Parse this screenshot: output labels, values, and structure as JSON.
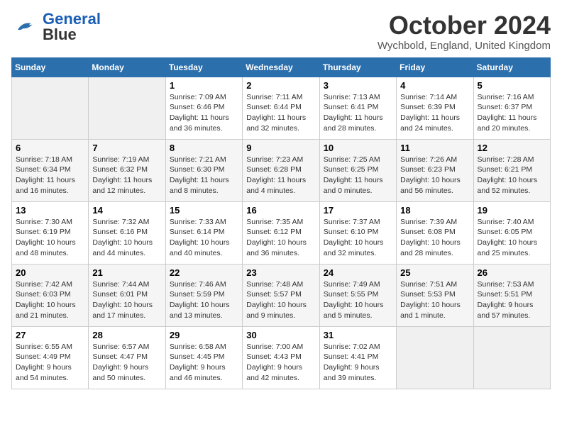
{
  "header": {
    "logo_line1": "General",
    "logo_line2": "Blue",
    "month": "October 2024",
    "location": "Wychbold, England, United Kingdom"
  },
  "days_of_week": [
    "Sunday",
    "Monday",
    "Tuesday",
    "Wednesday",
    "Thursday",
    "Friday",
    "Saturday"
  ],
  "weeks": [
    [
      {
        "day": "",
        "detail": ""
      },
      {
        "day": "",
        "detail": ""
      },
      {
        "day": "1",
        "detail": "Sunrise: 7:09 AM\nSunset: 6:46 PM\nDaylight: 11 hours and 36 minutes."
      },
      {
        "day": "2",
        "detail": "Sunrise: 7:11 AM\nSunset: 6:44 PM\nDaylight: 11 hours and 32 minutes."
      },
      {
        "day": "3",
        "detail": "Sunrise: 7:13 AM\nSunset: 6:41 PM\nDaylight: 11 hours and 28 minutes."
      },
      {
        "day": "4",
        "detail": "Sunrise: 7:14 AM\nSunset: 6:39 PM\nDaylight: 11 hours and 24 minutes."
      },
      {
        "day": "5",
        "detail": "Sunrise: 7:16 AM\nSunset: 6:37 PM\nDaylight: 11 hours and 20 minutes."
      }
    ],
    [
      {
        "day": "6",
        "detail": "Sunrise: 7:18 AM\nSunset: 6:34 PM\nDaylight: 11 hours and 16 minutes."
      },
      {
        "day": "7",
        "detail": "Sunrise: 7:19 AM\nSunset: 6:32 PM\nDaylight: 11 hours and 12 minutes."
      },
      {
        "day": "8",
        "detail": "Sunrise: 7:21 AM\nSunset: 6:30 PM\nDaylight: 11 hours and 8 minutes."
      },
      {
        "day": "9",
        "detail": "Sunrise: 7:23 AM\nSunset: 6:28 PM\nDaylight: 11 hours and 4 minutes."
      },
      {
        "day": "10",
        "detail": "Sunrise: 7:25 AM\nSunset: 6:25 PM\nDaylight: 11 hours and 0 minutes."
      },
      {
        "day": "11",
        "detail": "Sunrise: 7:26 AM\nSunset: 6:23 PM\nDaylight: 10 hours and 56 minutes."
      },
      {
        "day": "12",
        "detail": "Sunrise: 7:28 AM\nSunset: 6:21 PM\nDaylight: 10 hours and 52 minutes."
      }
    ],
    [
      {
        "day": "13",
        "detail": "Sunrise: 7:30 AM\nSunset: 6:19 PM\nDaylight: 10 hours and 48 minutes."
      },
      {
        "day": "14",
        "detail": "Sunrise: 7:32 AM\nSunset: 6:16 PM\nDaylight: 10 hours and 44 minutes."
      },
      {
        "day": "15",
        "detail": "Sunrise: 7:33 AM\nSunset: 6:14 PM\nDaylight: 10 hours and 40 minutes."
      },
      {
        "day": "16",
        "detail": "Sunrise: 7:35 AM\nSunset: 6:12 PM\nDaylight: 10 hours and 36 minutes."
      },
      {
        "day": "17",
        "detail": "Sunrise: 7:37 AM\nSunset: 6:10 PM\nDaylight: 10 hours and 32 minutes."
      },
      {
        "day": "18",
        "detail": "Sunrise: 7:39 AM\nSunset: 6:08 PM\nDaylight: 10 hours and 28 minutes."
      },
      {
        "day": "19",
        "detail": "Sunrise: 7:40 AM\nSunset: 6:05 PM\nDaylight: 10 hours and 25 minutes."
      }
    ],
    [
      {
        "day": "20",
        "detail": "Sunrise: 7:42 AM\nSunset: 6:03 PM\nDaylight: 10 hours and 21 minutes."
      },
      {
        "day": "21",
        "detail": "Sunrise: 7:44 AM\nSunset: 6:01 PM\nDaylight: 10 hours and 17 minutes."
      },
      {
        "day": "22",
        "detail": "Sunrise: 7:46 AM\nSunset: 5:59 PM\nDaylight: 10 hours and 13 minutes."
      },
      {
        "day": "23",
        "detail": "Sunrise: 7:48 AM\nSunset: 5:57 PM\nDaylight: 10 hours and 9 minutes."
      },
      {
        "day": "24",
        "detail": "Sunrise: 7:49 AM\nSunset: 5:55 PM\nDaylight: 10 hours and 5 minutes."
      },
      {
        "day": "25",
        "detail": "Sunrise: 7:51 AM\nSunset: 5:53 PM\nDaylight: 10 hours and 1 minute."
      },
      {
        "day": "26",
        "detail": "Sunrise: 7:53 AM\nSunset: 5:51 PM\nDaylight: 9 hours and 57 minutes."
      }
    ],
    [
      {
        "day": "27",
        "detail": "Sunrise: 6:55 AM\nSunset: 4:49 PM\nDaylight: 9 hours and 54 minutes."
      },
      {
        "day": "28",
        "detail": "Sunrise: 6:57 AM\nSunset: 4:47 PM\nDaylight: 9 hours and 50 minutes."
      },
      {
        "day": "29",
        "detail": "Sunrise: 6:58 AM\nSunset: 4:45 PM\nDaylight: 9 hours and 46 minutes."
      },
      {
        "day": "30",
        "detail": "Sunrise: 7:00 AM\nSunset: 4:43 PM\nDaylight: 9 hours and 42 minutes."
      },
      {
        "day": "31",
        "detail": "Sunrise: 7:02 AM\nSunset: 4:41 PM\nDaylight: 9 hours and 39 minutes."
      },
      {
        "day": "",
        "detail": ""
      },
      {
        "day": "",
        "detail": ""
      }
    ]
  ]
}
